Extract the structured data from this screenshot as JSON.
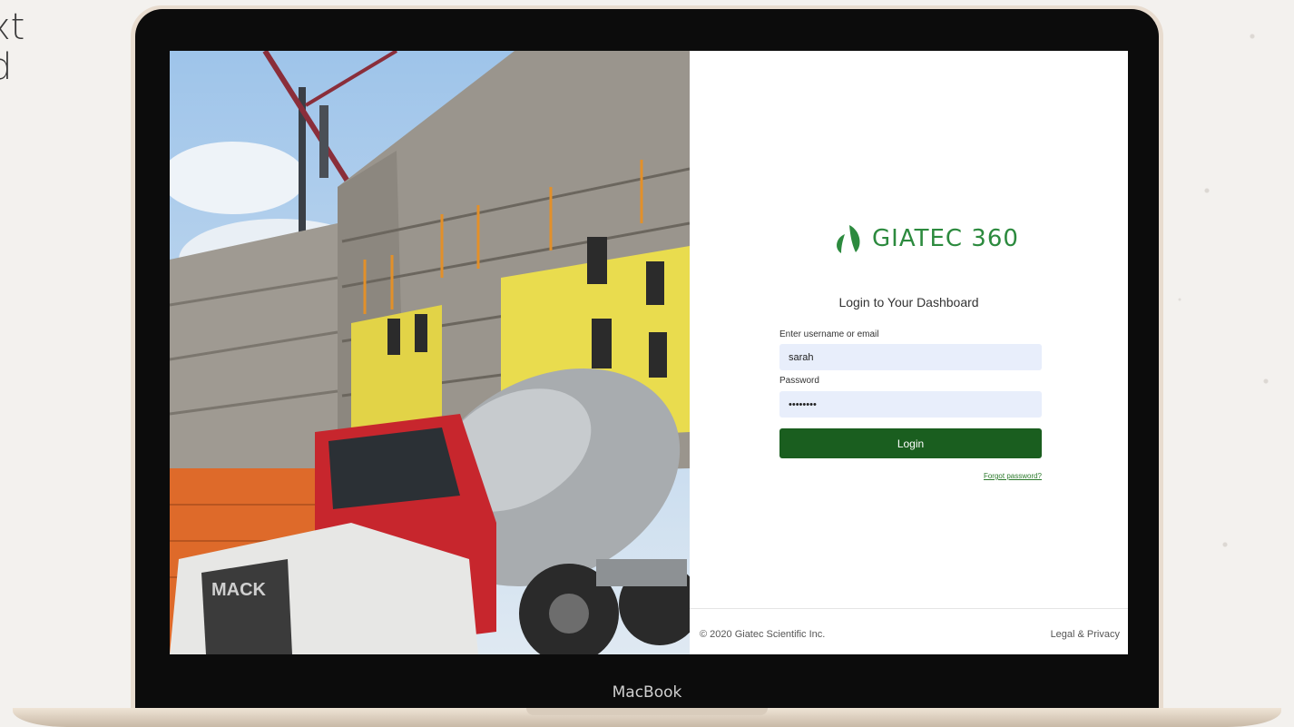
{
  "backdrop": {
    "side_text": "xt\nd"
  },
  "device": {
    "label": "MacBook"
  },
  "login": {
    "brand": "GIATEC 360",
    "brand_color": "#2c8a3e",
    "heading": "Login to Your Dashboard",
    "username_label": "Enter username or email",
    "username_value": "sarah",
    "password_label": "Password",
    "password_value": "••••••••",
    "login_button": "Login",
    "login_button_color": "#1a5e1f",
    "forgot_link": "Forgot password?"
  },
  "footer": {
    "copyright": "© 2020 Giatec Scientific Inc.",
    "legal": "Legal & Privacy"
  },
  "photo": {
    "truck_grille_text": "MACK"
  }
}
